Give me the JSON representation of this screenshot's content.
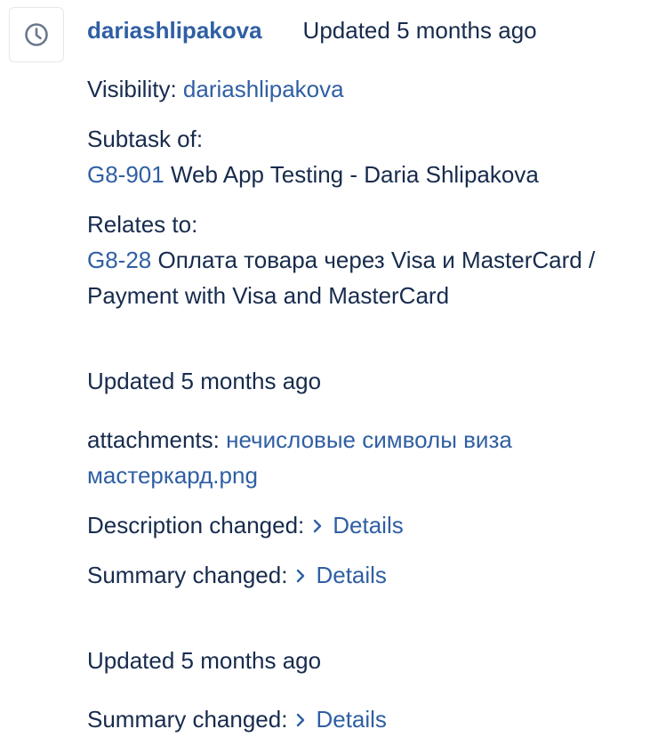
{
  "entry1": {
    "author": "dariashlipakova",
    "updated": "Updated 5 months ago",
    "visibility_label": "Visibility:",
    "visibility_value": "dariashlipakova",
    "subtask_label": "Subtask of:",
    "subtask_key": "G8-901",
    "subtask_title": "Web App Testing - Daria Shlipakova",
    "relates_label": "Relates to:",
    "relates_key": "G8-28",
    "relates_title": "Оплата товара через Visa и MasterCard / Payment with Visa and MasterCard"
  },
  "entry2": {
    "updated": "Updated 5 months ago",
    "attachments_label": "attachments:",
    "attachment_name": "нечисловые символы виза мастеркард.png",
    "description_label": "Description changed:",
    "description_link": "Details",
    "summary_label": "Summary changed:",
    "summary_link": "Details"
  },
  "entry3": {
    "updated": "Updated 5 months ago",
    "summary_label": "Summary changed:",
    "summary_link": "Details"
  },
  "icons": {
    "avatar": "clock-icon",
    "details": "chevron-right-icon"
  },
  "colors": {
    "link": "#2f5fa3",
    "text": "#172b4d",
    "icon": "#6b778c"
  }
}
